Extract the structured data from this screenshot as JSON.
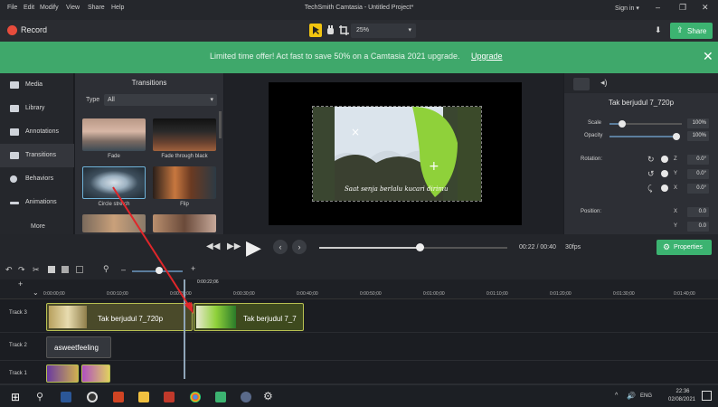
{
  "menu": [
    "File",
    "Edit",
    "Modify",
    "View",
    "Share",
    "Help"
  ],
  "window_title": "TechSmith Camtasia - Untitled Project*",
  "sign_in": "Sign in ▾",
  "toolbar": {
    "record_label": "Record",
    "zoom": "25%",
    "share_label": "Share"
  },
  "banner": {
    "text": "Limited time offer! Act fast to save 50% on a Camtasia 2021 upgrade.",
    "link": "Upgrade"
  },
  "nav": {
    "items": [
      {
        "label": "Media",
        "icon": "film-icon"
      },
      {
        "label": "Library",
        "icon": "library-icon"
      },
      {
        "label": "Annotations",
        "icon": "annotation-icon"
      },
      {
        "label": "Transitions",
        "icon": "transitions-icon"
      },
      {
        "label": "Behaviors",
        "icon": "behaviors-icon"
      },
      {
        "label": "Animations",
        "icon": "animations-icon"
      }
    ],
    "more": "More"
  },
  "transitions": {
    "title": "Transitions",
    "type_label": "Type",
    "type_value": "All",
    "thumbs": [
      {
        "label": "Fade"
      },
      {
        "label": "Fade through black"
      },
      {
        "label": "Circle stretch"
      },
      {
        "label": "Flip"
      }
    ]
  },
  "canvas": {
    "caption": "Saat senja berlalu kucari dirimu"
  },
  "properties": {
    "title": "Tak berjudul 7_720p",
    "scale_label": "Scale",
    "scale_value": "100%",
    "opacity_label": "Opacity",
    "opacity_value": "100%",
    "rotation_label": "Rotation:",
    "rot_z_label": "Z",
    "rot_z": "0.0°",
    "rot_y_label": "Y",
    "rot_y": "0.0°",
    "rot_x_label": "X",
    "rot_x": "0.0°",
    "position_label": "Position:",
    "pos_x_label": "X",
    "pos_x": "0.0",
    "pos_y_label": "Y",
    "pos_y": "0.0"
  },
  "playback": {
    "timecode": "00:22 / 00:40",
    "fps": "30fps",
    "properties_label": "Properties"
  },
  "timeline": {
    "playhead_time": "0:00:22;06",
    "ticks": [
      "0:00:00;00",
      "0:00:10;00",
      "0:00:20;00",
      "0:00:30;00",
      "0:00:40;00",
      "0:00:50;00",
      "0:01:00;00",
      "0:01:10;00",
      "0:01:20;00",
      "0:01:30;00",
      "0:01:40;00"
    ],
    "tracks": [
      {
        "label": "Track 3",
        "clips": [
          "Tak berjudul 7_720p",
          "Tak berjudul 7_7"
        ]
      },
      {
        "label": "Track 2",
        "clips": [
          "asweetfeeling"
        ]
      },
      {
        "label": "Track 1",
        "clips": []
      }
    ]
  },
  "taskbar": {
    "lang": "ENG",
    "time": "22:36",
    "date": "02/08/2021"
  }
}
